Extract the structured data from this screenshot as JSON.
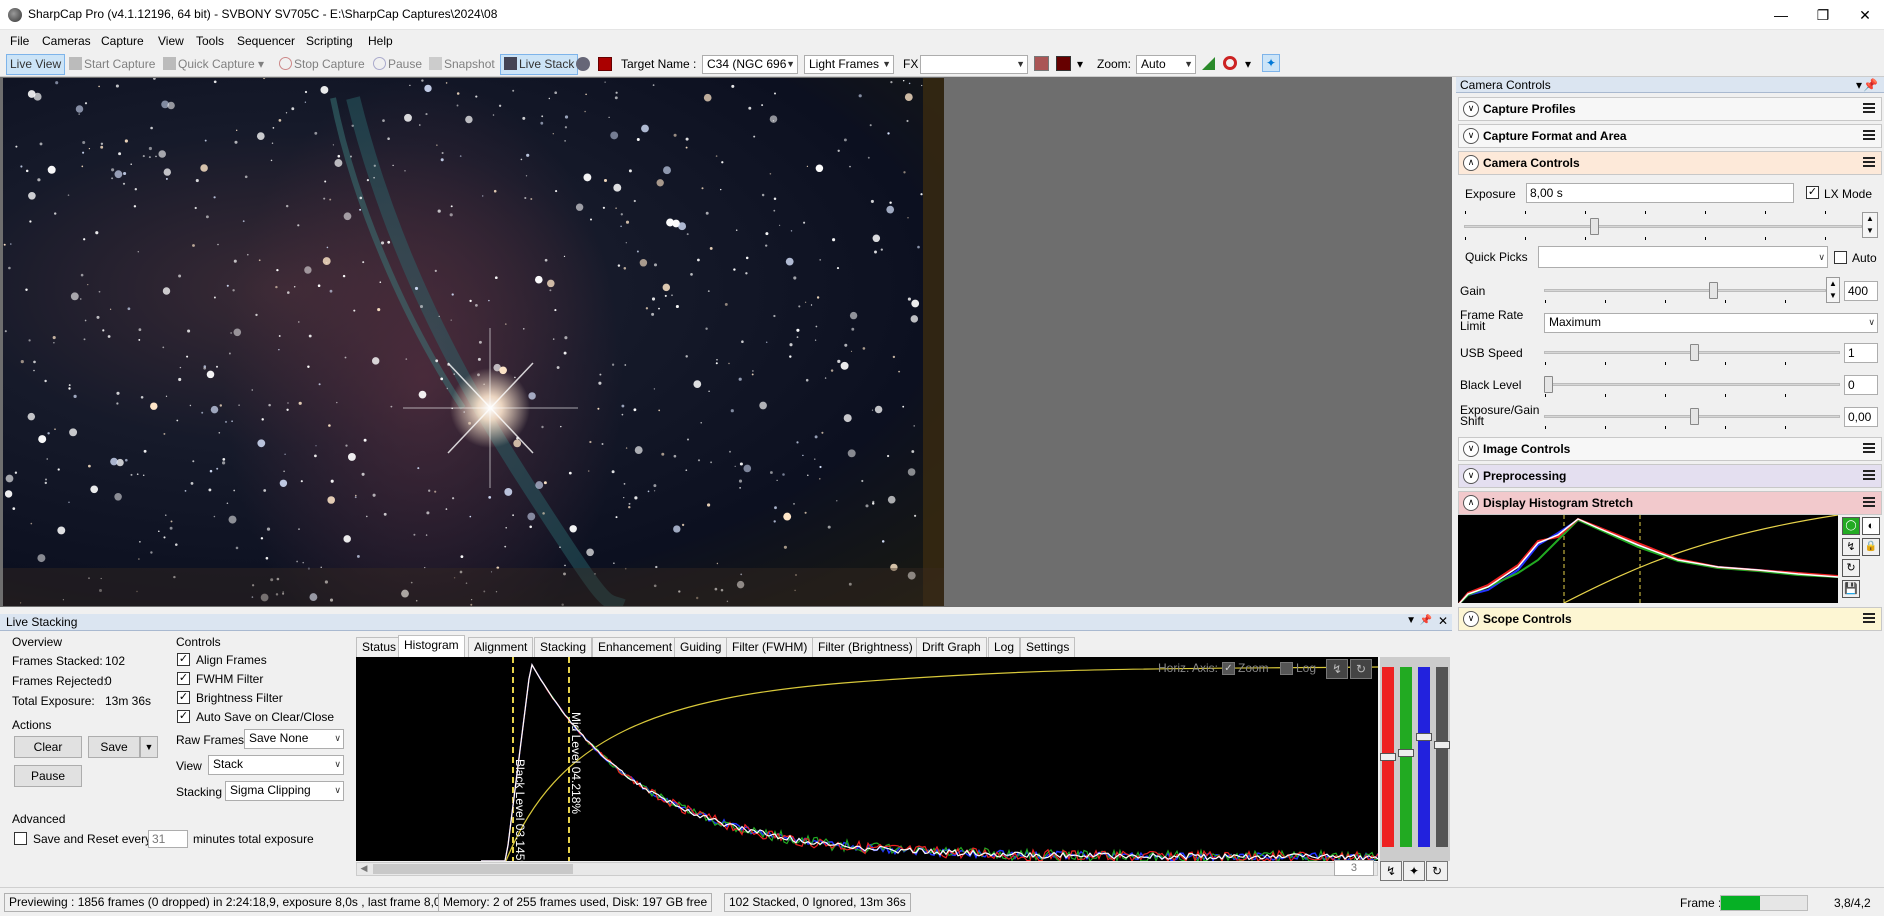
{
  "window": {
    "title": "SharpCap Pro (v4.1.12196, 64 bit) - SVBONY SV705C - E:\\SharpCap Captures\\2024\\08",
    "minimize_icon": "minimize-icon",
    "maximize_icon": "restore-icon",
    "close_icon": "close-icon"
  },
  "menu": [
    "File",
    "Cameras",
    "Capture",
    "View",
    "Tools",
    "Sequencer",
    "Scripting",
    "Help"
  ],
  "toolbar": {
    "live_view": "Live View",
    "start_capture": "Start Capture",
    "quick_capture": "Quick Capture",
    "stop_capture": "Stop Capture",
    "pause": "Pause",
    "snapshot": "Snapshot",
    "live_stack": "Live Stack",
    "target_name_label": "Target Name :",
    "target_name_value": "C34 (NGC 696",
    "frame_type_value": "Light Frames",
    "fx_label": "FX",
    "fx_value": "",
    "zoom_label": "Zoom:",
    "zoom_value": "Auto"
  },
  "camera_controls_panel": {
    "title": "Camera Controls",
    "sections": {
      "capture_profiles": "Capture Profiles",
      "capture_format": "Capture Format and Area",
      "camera_controls": "Camera Controls",
      "image_controls": "Image Controls",
      "preprocessing": "Preprocessing",
      "display_histogram": "Display Histogram Stretch",
      "scope_controls": "Scope Controls"
    },
    "exposure_label": "Exposure",
    "exposure_value": "8,00 s",
    "lx_mode_label": "LX Mode",
    "lx_mode_checked": true,
    "quick_picks_label": "Quick Picks",
    "quick_picks_value": "",
    "auto_label": "Auto",
    "gain_label": "Gain",
    "gain_value": "400",
    "gain_level": 0.6,
    "frame_rate_label": "Frame Rate Limit",
    "frame_rate_value": "Maximum",
    "usb_speed_label": "USB Speed",
    "usb_speed_value": "1",
    "black_level_label": "Black Level",
    "black_level_value": "0",
    "exp_gain_shift_label": "Exposure/Gain Shift",
    "exp_gain_shift_value": "0,00"
  },
  "live_stacking": {
    "title": "Live Stacking",
    "overview_label": "Overview",
    "frames_stacked_label": "Frames Stacked:",
    "frames_stacked_value": "102",
    "frames_rejected_label": "Frames Rejected:",
    "frames_rejected_value": "0",
    "total_exposure_label": "Total Exposure:",
    "total_exposure_value": "13m 36s",
    "actions_label": "Actions",
    "clear_label": "Clear",
    "save_label": "Save",
    "pause_label": "Pause",
    "advanced_label": "Advanced",
    "save_reset_label": "Save and Reset every",
    "save_reset_value": "31",
    "save_reset_suffix": "minutes total exposure",
    "controls_label": "Controls",
    "align_frames": "Align Frames",
    "fwhm_filter": "FWHM Filter",
    "brightness_filter": "Brightness Filter",
    "auto_save": "Auto Save on Clear/Close",
    "raw_frames_label": "Raw Frames",
    "raw_frames_value": "Save None",
    "view_label": "View",
    "view_value": "Stack",
    "stacking_label": "Stacking",
    "stacking_value": "Sigma Clipping",
    "tabs": [
      "Status",
      "Histogram",
      "Alignment",
      "Stacking",
      "Enhancement",
      "Guiding",
      "Filter (FWHM)",
      "Filter (Brightness)",
      "Drift Graph",
      "Log",
      "Settings"
    ],
    "selected_tab": "Histogram",
    "horiz_axis_label": "Horiz. Axis:",
    "zoom_check_label": "Zoom",
    "log_check_label": "Log",
    "black_level_marker": "Black Level 03.145%",
    "mid_level_marker": "Mid Level 04.218%",
    "spinner_value": "3"
  },
  "status": {
    "preview": "Previewing : 1856 frames (0 dropped) in 2:24:18,9, exposure 8,0s , last frame 8,0s",
    "memory": "Memory: 2 of 255 frames used, Disk: 197 GB free",
    "stacked": "102 Stacked, 0 Ignored, 13m 36s",
    "frame_label": "Frame :",
    "frame_progress": 0.45,
    "frame_value": "3,8/4,2"
  },
  "colors": {
    "accent": "#0078d7",
    "camera_controls_hdr": "#fde9d9",
    "preprocessing_hdr": "#e4dff0",
    "display_histo_hdr": "#f2c9cc",
    "scope_hdr": "#fdf6d3",
    "progress_green": "#06b025"
  }
}
